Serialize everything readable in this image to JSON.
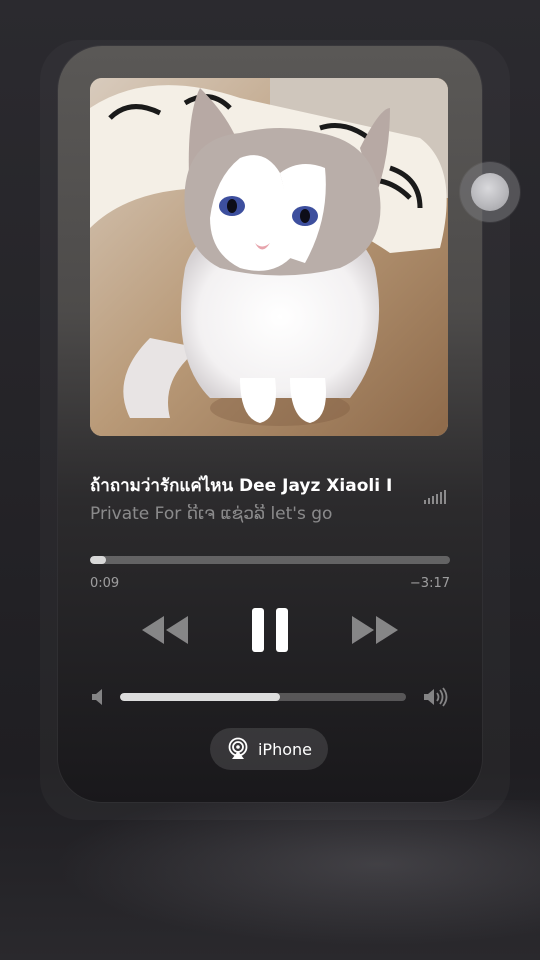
{
  "now_playing": {
    "title": "ถ้าถามว่ารักแค่ไหน Dee Jayz Xiaoli I",
    "artist": "Private For ດີເຈ ແຊ່ວລີ let's go",
    "elapsed": "0:09",
    "remaining": "−3:17",
    "progress_fraction": 0.045,
    "is_playing": true
  },
  "controls": {
    "rewind_icon": "rewind-icon",
    "pause_icon": "pause-icon",
    "forward_icon": "fast-forward-icon"
  },
  "volume": {
    "level_fraction": 0.56,
    "low_icon": "volume-low-icon",
    "high_icon": "volume-high-icon"
  },
  "output": {
    "device_label": "iPhone",
    "icon": "airplay-icon"
  },
  "artwork": {
    "icon": "album-artwork-cat"
  },
  "colors": {
    "accent": "#ffffff",
    "secondary_text": "#8a8a8e"
  }
}
